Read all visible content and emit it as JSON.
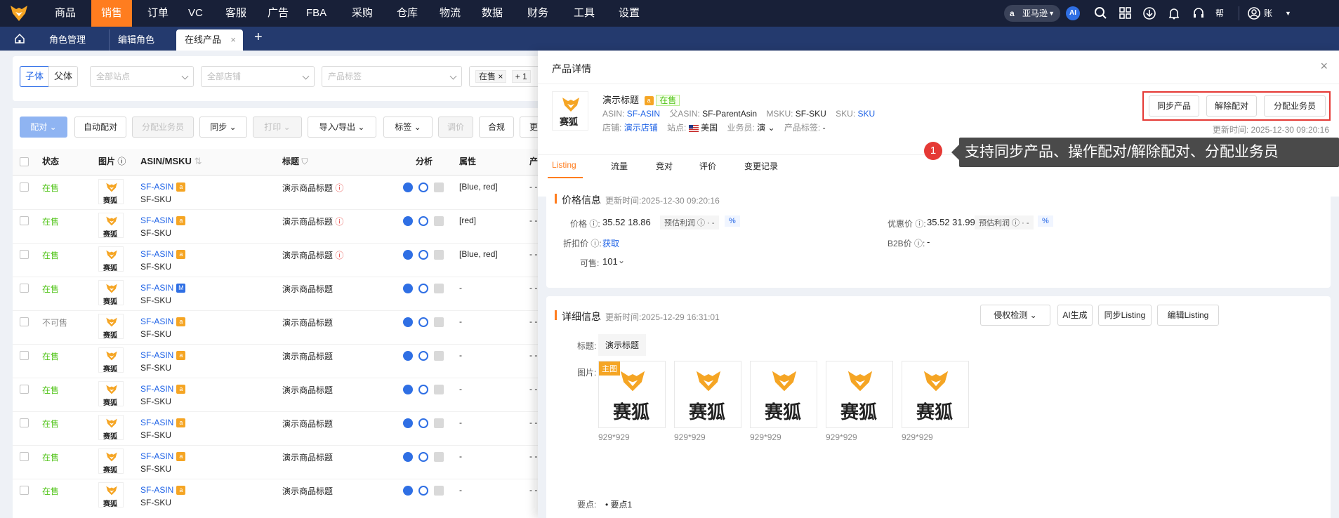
{
  "topnav": {
    "items": [
      "商品",
      "销售",
      "订单",
      "VC",
      "客服",
      "广告",
      "FBA",
      "采购",
      "仓库",
      "物流",
      "数据",
      "财务",
      "工具",
      "设置"
    ],
    "active": "销售",
    "marketplace": "亚马逊",
    "help": "帮助",
    "account": "账户"
  },
  "tabs": [
    "角色管理",
    "编辑角色",
    "在线产品"
  ],
  "filters": {
    "child": "子体",
    "parent": "父体",
    "site": "全部站点",
    "shop": "全部店铺",
    "tag": "产品标签",
    "status_chip": "在售",
    "more_chip": "+ 1"
  },
  "toolbar": {
    "pair": "配对",
    "auto_pair": "自动配对",
    "assign": "分配业务员",
    "sync": "同步",
    "print": "打印",
    "import_export": "导入/导出",
    "tag": "标签",
    "price": "调价",
    "compliance": "合规",
    "more": "更"
  },
  "table": {
    "headers": {
      "status": "状态",
      "image": "图片",
      "asin": "ASIN/MSKU",
      "title": "标题",
      "analysis": "分析",
      "attr": "属性",
      "product": "产品"
    },
    "rows": [
      {
        "status": "在售",
        "asin": "SF-ASIN",
        "sku": "SF-SKU",
        "title": "演示商品标题",
        "warn": true,
        "attr": "[Blue, red]",
        "badge": "a"
      },
      {
        "status": "在售",
        "asin": "SF-ASIN",
        "sku": "SF-SKU",
        "title": "演示商品标题",
        "warn": true,
        "attr": "[red]",
        "badge": "a"
      },
      {
        "status": "在售",
        "asin": "SF-ASIN",
        "sku": "SF-SKU",
        "title": "演示商品标题",
        "warn": true,
        "attr": "[Blue, red]",
        "badge": "a"
      },
      {
        "status": "在售",
        "asin": "SF-ASIN",
        "sku": "SF-SKU",
        "title": "演示商品标题",
        "warn": false,
        "attr": "-",
        "badge": "M"
      },
      {
        "status": "不可售",
        "asin": "SF-ASIN",
        "sku": "SF-SKU",
        "title": "演示商品标题",
        "warn": false,
        "attr": "-",
        "badge": "a"
      },
      {
        "status": "在售",
        "asin": "SF-ASIN",
        "sku": "SF-SKU",
        "title": "演示商品标题",
        "warn": false,
        "attr": "-",
        "badge": "a"
      },
      {
        "status": "在售",
        "asin": "SF-ASIN",
        "sku": "SF-SKU",
        "title": "演示商品标题",
        "warn": false,
        "attr": "-",
        "badge": "a"
      },
      {
        "status": "在售",
        "asin": "SF-ASIN",
        "sku": "SF-SKU",
        "title": "演示商品标题",
        "warn": false,
        "attr": "-",
        "badge": "a"
      },
      {
        "status": "在售",
        "asin": "SF-ASIN",
        "sku": "SF-SKU",
        "title": "演示商品标题",
        "warn": false,
        "attr": "-",
        "badge": "a"
      },
      {
        "status": "在售",
        "asin": "SF-ASIN",
        "sku": "SF-SKU",
        "title": "演示商品标题",
        "warn": false,
        "attr": "-",
        "badge": "a"
      }
    ],
    "cell_dash": "- -",
    "logo_text": "赛狐"
  },
  "drawer": {
    "title": "产品详情",
    "product_title": "演示标题",
    "status": "在售",
    "asin_label": "ASIN:",
    "asin": "SF-ASIN",
    "parent_label": "父ASIN:",
    "parent": "SF-ParentAsin",
    "msku_label": "MSKU:",
    "msku": "SF-SKU",
    "sku_label": "SKU:",
    "sku": "SKU",
    "shop_label": "店铺:",
    "shop": "演示店铺",
    "site_label": "站点:",
    "site": "美国",
    "sales_label": "业务员:",
    "sales": "演",
    "ptag_label": "产品标签:",
    "ptag": "-",
    "btn_sync": "同步产品",
    "btn_unpair": "解除配对",
    "btn_assign": "分配业务员",
    "updated": "更新时间: 2025-12-30 09:20:16",
    "callout_num": "1",
    "callout": "支持同步产品、操作配对/解除配对、分配业务员",
    "tabs": [
      "Listing",
      "流量",
      "竞对",
      "评价",
      "变更记录"
    ],
    "price": {
      "title": "价格信息",
      "updated": "更新时间:2025-12-30 09:20:16",
      "price_label": "价格",
      "price": "35.52 18.86",
      "profit_label": "预估利润",
      "profit": "-",
      "discount_label": "优惠价",
      "discount": "35.52 31.99",
      "profit2": "-",
      "coupon_label": "折扣价",
      "coupon": "获取",
      "b2b_label": "B2B价",
      "b2b": "-",
      "avail_label": "可售:",
      "avail": "101"
    },
    "detail": {
      "title": "详细信息",
      "updated": "更新时间:2025-12-29 16:31:01",
      "btn_infringe": "侵权检测",
      "btn_ai": "AI生成",
      "btn_sync": "同步Listing",
      "btn_edit": "编辑Listing",
      "title_label": "标题:",
      "title_value": "演示标题",
      "img_label": "图片:",
      "main_badge": "主图",
      "dims": [
        "929*929",
        "929*929",
        "929*929",
        "929*929",
        "929*929"
      ],
      "points_label": "要点:",
      "point1": "要点1"
    }
  },
  "colors": {
    "topnav": "#182038",
    "active": "#ff7d1f",
    "tabbar": "#243a6e",
    "link": "#1f63e6",
    "green": "#52c41a",
    "callout": "#4a4a4a",
    "red": "#e53935"
  }
}
